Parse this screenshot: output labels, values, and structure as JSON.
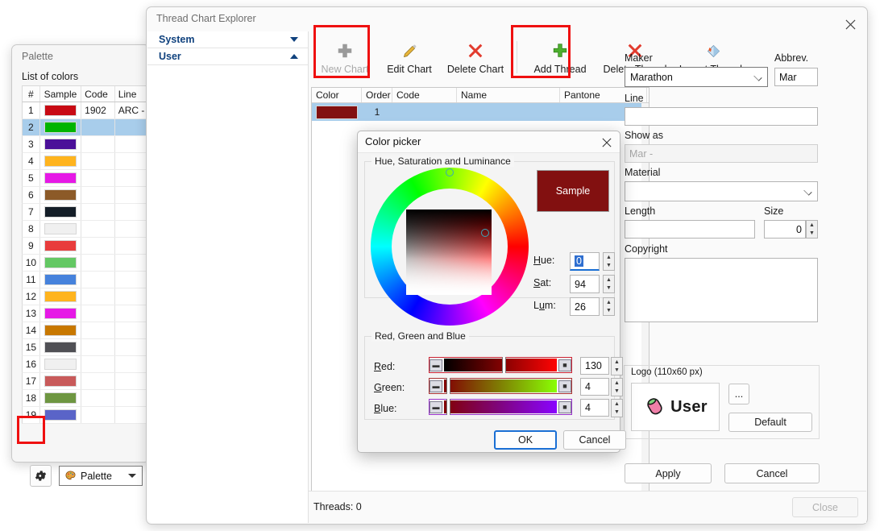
{
  "palette_window": {
    "title": "Palette",
    "subtitle": "List of colors",
    "columns": [
      "#",
      "Sample",
      "Code",
      "Line"
    ],
    "rows": [
      {
        "n": "1",
        "color": "#c80a14",
        "code": "1902",
        "line": "ARC - Isa",
        "selected": false
      },
      {
        "n": "2",
        "color": "#00b400",
        "code": "",
        "line": "",
        "selected": true
      },
      {
        "n": "3",
        "color": "#4b1099",
        "code": "",
        "line": "",
        "selected": false
      },
      {
        "n": "4",
        "color": "#ffb41e",
        "code": "",
        "line": "",
        "selected": false
      },
      {
        "n": "5",
        "color": "#e619e6",
        "code": "",
        "line": "",
        "selected": false
      },
      {
        "n": "6",
        "color": "#8c5a28",
        "code": "",
        "line": "",
        "selected": false
      },
      {
        "n": "7",
        "color": "#141e28",
        "code": "",
        "line": "",
        "selected": false
      },
      {
        "n": "8",
        "color": "#f0f0f0",
        "code": "",
        "line": "",
        "selected": false
      },
      {
        "n": "9",
        "color": "#e83c3c",
        "code": "",
        "line": "",
        "selected": false
      },
      {
        "n": "10",
        "color": "#64c864",
        "code": "",
        "line": "",
        "selected": false
      },
      {
        "n": "11",
        "color": "#4682dc",
        "code": "",
        "line": "",
        "selected": false
      },
      {
        "n": "12",
        "color": "#ffb41e",
        "code": "",
        "line": "",
        "selected": false
      },
      {
        "n": "13",
        "color": "#e619e6",
        "code": "",
        "line": "",
        "selected": false
      },
      {
        "n": "14",
        "color": "#c87800",
        "code": "",
        "line": "",
        "selected": false
      },
      {
        "n": "15",
        "color": "#505055",
        "code": "",
        "line": "",
        "selected": false
      },
      {
        "n": "16",
        "color": "#f0f0f0",
        "code": "",
        "line": "",
        "selected": false
      },
      {
        "n": "17",
        "color": "#c85a5a",
        "code": "",
        "line": "",
        "selected": false
      },
      {
        "n": "18",
        "color": "#6e9641",
        "code": "",
        "line": "",
        "selected": false
      },
      {
        "n": "19",
        "color": "#5a64c8",
        "code": "",
        "line": "",
        "selected": false
      }
    ],
    "settings_button_label": "",
    "palette_combo_value": "Palette"
  },
  "explorer": {
    "title": "Thread Chart Explorer",
    "sidebar": [
      {
        "label": "System",
        "arrow": "⌄",
        "expanded": false
      },
      {
        "label": "User",
        "arrow": "⌃",
        "expanded": true
      }
    ],
    "toolbar": [
      {
        "label": "New Chart",
        "icon": "plus-grey-icon",
        "disabled": true,
        "highlighted": true
      },
      {
        "label": "Edit Chart",
        "icon": "pencil-icon",
        "disabled": false,
        "highlighted": false
      },
      {
        "label": "Delete Chart",
        "icon": "red-x-icon",
        "disabled": false,
        "highlighted": false
      },
      {
        "label": "Add Thread",
        "icon": "plus-green-icon",
        "disabled": false,
        "highlighted": true
      },
      {
        "label": "Delete Thread",
        "icon": "red-x-icon",
        "disabled": false,
        "highlighted": false
      },
      {
        "label": "Import Threads",
        "icon": "import-icon",
        "disabled": false,
        "highlighted": false
      }
    ],
    "grid": {
      "columns": [
        "Color",
        "Order",
        "Code",
        "Name",
        "Pantone"
      ],
      "rows": [
        {
          "color": "#821010",
          "order": "1",
          "code": "",
          "name": "",
          "pantone": "",
          "selected": true
        }
      ]
    },
    "detail": {
      "maker_label": "Maker",
      "maker_value": "Marathon",
      "abbrev_label": "Abbrev.",
      "abbrev_value": "Mar",
      "line_label": "Line",
      "line_value": "",
      "show_as_label": "Show as",
      "show_as_placeholder": "Mar -",
      "material_label": "Material",
      "material_value": "",
      "length_label": "Length",
      "length_value": "",
      "size_label": "Size",
      "size_value": "0",
      "copyright_label": "Copyright",
      "copyright_value": "",
      "logo_label": "Logo (110x60 px)",
      "logo_text": "User",
      "browse_label": "...",
      "default_label": "Default",
      "apply_label": "Apply",
      "cancel_label": "Cancel"
    },
    "status": {
      "threads_label": "Threads: 0",
      "close_label": "Close"
    }
  },
  "color_picker": {
    "title": "Color picker",
    "hsl_group_label": "Hue, Saturation and Luminance",
    "sample_label": "Sample",
    "sample_color": "#821010",
    "hue": {
      "label": "Hue:",
      "value": "0",
      "selected": true
    },
    "sat": {
      "label": "Sat:",
      "value": "94",
      "selected": false
    },
    "lum": {
      "label": "Lum:",
      "value": "26",
      "selected": false
    },
    "rgb_group_label": "Red, Green and Blue",
    "red": {
      "label": "Red:",
      "value": "130",
      "percent": 51
    },
    "green": {
      "label": "Green:",
      "value": "4",
      "percent": 2
    },
    "blue": {
      "label": "Blue:",
      "value": "4",
      "percent": 2
    },
    "ok_label": "OK",
    "cancel_label": "Cancel"
  },
  "colors": {
    "accent_blue": "#1a6fd4",
    "selection_blue": "#a8cdeb",
    "highlight_red": "#ef1010",
    "sidebar_link": "#10427e"
  }
}
